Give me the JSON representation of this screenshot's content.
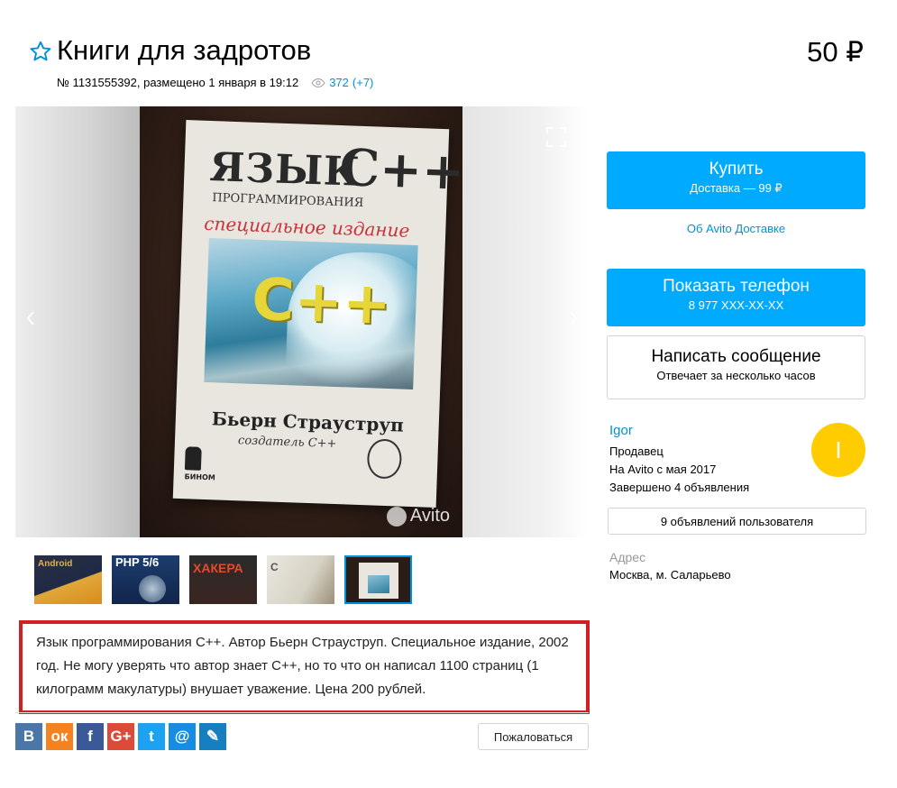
{
  "listing": {
    "title": "Книги для задротов",
    "price": "50 ₽",
    "meta": "№ 1131555392, размещено 1 января в 19:12",
    "views": "372",
    "views_delta": "(+7)"
  },
  "gallery": {
    "photo": {
      "title_line1": "ЯЗЫК",
      "title_cpp": "C++",
      "subtitle": "ПРОГРАММИРОВАНИЯ",
      "edition": "специальное издание",
      "logo": "C++",
      "author": "Бьерн Страуструп",
      "creator": "создатель C++",
      "publisher": "БИНОМ"
    },
    "watermark": "Avito",
    "prev_icon": "chevron-left-icon",
    "next_icon": "chevron-right-icon",
    "expand_icon": "fullscreen-icon",
    "thumbnails": [
      {
        "label": "Android"
      },
      {
        "label": "PHP 5/6"
      },
      {
        "label": "ХАКЕРА"
      },
      {
        "label": "C"
      },
      {
        "label": ""
      }
    ]
  },
  "description": "Язык программирования С++. Автор Бьерн Страуструп. Специальное издание, 2002 год. Не могу уверять что автор знает С++, но то что он написал 1100 страниц (1 килограмм макулатуры) внушает уважение. Цена 200 рублей.",
  "share": {
    "buttons": [
      {
        "icon": "vk-icon",
        "label": "В",
        "color": "#4a76a8"
      },
      {
        "icon": "odnoklassniki-icon",
        "label": "ок",
        "color": "#f58220"
      },
      {
        "icon": "facebook-icon",
        "label": "f",
        "color": "#3b5998"
      },
      {
        "icon": "google-plus-icon",
        "label": "G+",
        "color": "#dc4a38"
      },
      {
        "icon": "twitter-icon",
        "label": "t",
        "color": "#1da1f2"
      },
      {
        "icon": "mail-icon",
        "label": "@",
        "color": "#168de2"
      },
      {
        "icon": "livejournal-icon",
        "label": "✎",
        "color": "#157fc0"
      }
    ],
    "report_label": "Пожаловаться"
  },
  "sidebar": {
    "buy": {
      "label": "Купить",
      "sub": "Доставка — 99 ₽"
    },
    "delivery_link": "Об Avito Доставке",
    "phone": {
      "label": "Показать телефон",
      "sub": "8 977 XXX-XX-XX"
    },
    "message": {
      "label": "Написать сообщение",
      "sub": "Отвечает за несколько часов"
    },
    "seller": {
      "name": "Igor",
      "role": "Продавец",
      "since": "На Avito с мая 2017",
      "completed": "Завершено 4 объявления",
      "avatar_letter": "I",
      "avatar_color": "#ffcc00"
    },
    "ads_button": "9 объявлений пользователя",
    "address_label": "Адрес",
    "address_value": "Москва, м. Саларьево"
  },
  "colors": {
    "accent": "#00aaff",
    "link": "#0091d9",
    "highlight_border": "#d01f25"
  }
}
